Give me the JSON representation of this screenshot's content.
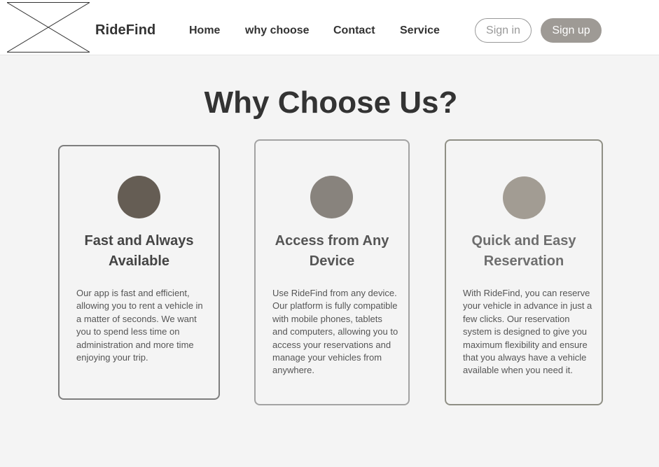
{
  "header": {
    "logo_placeholder": "logo-placeholder",
    "brand": "RideFind",
    "nav": [
      {
        "label": "Home"
      },
      {
        "label": "why choose"
      },
      {
        "label": "Contact"
      },
      {
        "label": "Service"
      }
    ],
    "sign_in_label": "Sign in",
    "sign_up_label": "Sign up"
  },
  "main": {
    "title": "Why Choose Us?",
    "cards": [
      {
        "title_line1": "Fast and Always",
        "title_line2": "Available",
        "text": "Our app is fast and efficient, allowing you to rent a vehicle in a matter of seconds. We want you to spend less time on administration and more time enjoying your trip.",
        "circle_color": "#655d54",
        "title_color": "#444444"
      },
      {
        "title_line1": "Access from Any",
        "title_line2": "Device",
        "text": "Use RideFind from any device. Our platform is fully compatible with mobile phones, tablets and computers, allowing you to access your reservations and manage your vehicles from anywhere.",
        "circle_color": "#88837d",
        "title_color": "#555555"
      },
      {
        "title_line1": "Quick and Easy",
        "title_line2": "Reservation",
        "text": "With RideFind, you can reserve your vehicle in advance in just a few clicks. Our reservation system is designed to give you maximum flexibility and ensure that you always have a vehicle available when you need it.",
        "circle_color": "#a29c93",
        "title_color": "#6e6e6e"
      }
    ]
  },
  "colors": {
    "background": "#f4f4f4",
    "header_bg": "#ffffff",
    "sign_up_bg": "#9e9a95",
    "sign_in_border": "#999999"
  }
}
